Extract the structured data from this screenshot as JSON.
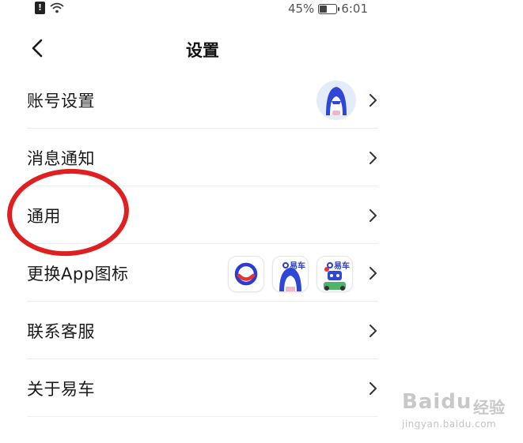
{
  "status_bar": {
    "battery_text": "45%",
    "battery_level": 0.45,
    "time": "6:01",
    "icons": [
      "sim-alert-icon",
      "wifi-icon",
      "battery-icon"
    ]
  },
  "nav": {
    "title": "设置",
    "back_icon": "back-chevron-icon"
  },
  "settings": {
    "items": [
      {
        "label": "账号设置",
        "accessory": "avatar"
      },
      {
        "label": "消息通知"
      },
      {
        "label": "通用"
      },
      {
        "label": "更换App图标",
        "accessory": "app-icons"
      },
      {
        "label": "联系客服"
      },
      {
        "label": "关于易车"
      }
    ]
  },
  "app_icons": {
    "brand_text": "易车",
    "options": [
      "logo-icon-default",
      "shark-icon-brand",
      "character-icon-brand"
    ]
  },
  "annotation": {
    "color": "#e02020",
    "target": "通用"
  },
  "watermark": {
    "brand": "Baidu",
    "suffix": "经验",
    "url": "jingyan.baidu.com"
  },
  "colors": {
    "text": "#1a1a1a",
    "chevron": "#333333",
    "divider": "#eeeeee",
    "brand_blue": "#2a3bd8",
    "brand_red": "#e8352b"
  }
}
